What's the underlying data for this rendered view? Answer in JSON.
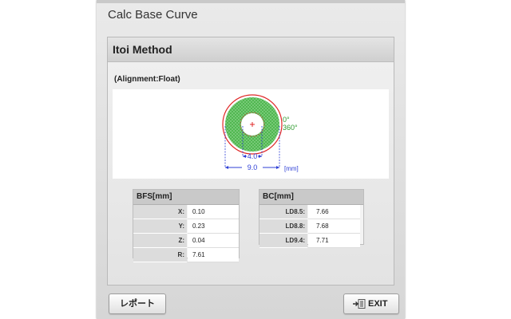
{
  "window": {
    "title": "Calc Base Curve"
  },
  "panel": {
    "title": "Itoi Method",
    "alignment": "(Alignment:Float)"
  },
  "diagram": {
    "angle_label_0": "0°",
    "angle_label_360": "360°",
    "inner_dim": "4.0",
    "outer_dim": "9.0",
    "unit": "[mm]",
    "colors": {
      "ring": "#3cad3c",
      "outline": "#e02828",
      "dimension": "#2e3fd6"
    }
  },
  "bfs_table": {
    "title": "BFS[mm]",
    "rows": [
      {
        "label": "X:",
        "value": "0.10"
      },
      {
        "label": "Y:",
        "value": "0.23"
      },
      {
        "label": "Z:",
        "value": "0.04"
      },
      {
        "label": "R:",
        "value": "7.61"
      }
    ]
  },
  "bc_table": {
    "title": "BC[mm]",
    "rows": [
      {
        "label": "LD8.5:",
        "value": "7.66"
      },
      {
        "label": "LD8.8:",
        "value": "7.68"
      },
      {
        "label": "LD9.4:",
        "value": "7.71"
      }
    ]
  },
  "footer": {
    "report_label": "レポート",
    "exit_label": "EXIT",
    "exit_icon": "exit-door-icon"
  }
}
